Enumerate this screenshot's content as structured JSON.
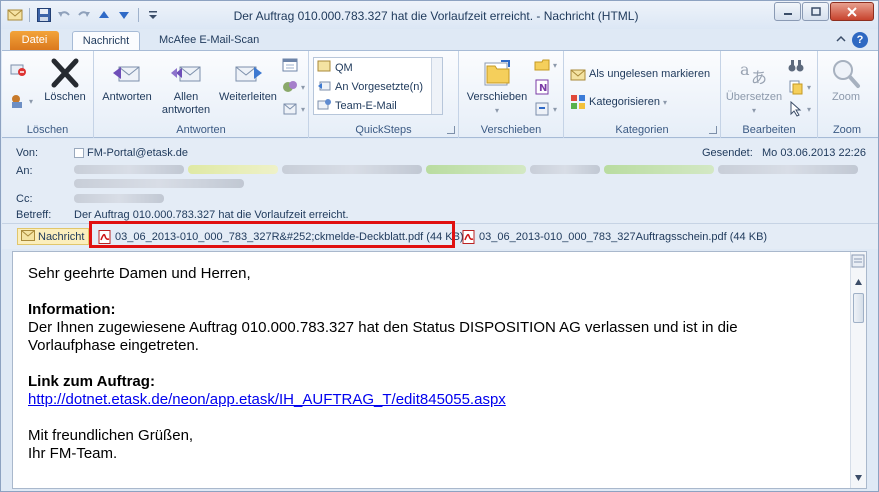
{
  "window": {
    "title": "Der Auftrag 010.000.783.327 hat die Vorlaufzeit erreicht.  -  Nachricht (HTML)"
  },
  "tabs": {
    "file": "Datei",
    "message": "Nachricht",
    "mcafee": "McAfee E-Mail-Scan"
  },
  "ribbon": {
    "delete_group": {
      "delete_label": "Löschen",
      "group_label": "Löschen"
    },
    "respond_group": {
      "reply": "Antworten",
      "reply_all_line1": "Allen",
      "reply_all_line2": "antworten",
      "forward": "Weiterleiten",
      "group_label": "Antworten"
    },
    "quicksteps": {
      "items": [
        "QM",
        "An Vorgesetzte(n)",
        "Team-E-Mail"
      ],
      "group_label": "QuickSteps"
    },
    "move_group": {
      "move_label": "Verschieben",
      "group_label": "Verschieben"
    },
    "tags_group": {
      "mark_unread": "Als ungelesen markieren",
      "categorize": "Kategorisieren",
      "group_label": "Kategorien"
    },
    "editing_group": {
      "translate": "Übersetzen",
      "group_label": "Bearbeiten"
    },
    "zoom_group": {
      "zoom": "Zoom",
      "group_label": "Zoom"
    }
  },
  "header": {
    "from_label": "Von:",
    "from_value": "FM-Portal@etask.de",
    "to_label": "An:",
    "cc_label": "Cc:",
    "subject_label": "Betreff:",
    "subject_value": "Der Auftrag 010.000.783.327 hat die Vorlaufzeit erreicht.",
    "sent_label": "Gesendet:",
    "sent_value": "Mo 03.06.2013 22:26"
  },
  "attachments": {
    "message_tab": "Nachricht",
    "files": [
      "03_06_2013-010_000_783_327R&#252;ckmelde-Deckblatt.pdf (44 KB)",
      "03_06_2013-010_000_783_327Auftragsschein.pdf (44 KB)"
    ]
  },
  "body": {
    "greeting": "Sehr geehrte Damen und Herren,",
    "info_heading": "Information:",
    "info_text_line1": "Der Ihnen zugewiesene Auftrag 010.000.783.327 hat den Status DISPOSITION AG verlassen und ist in die",
    "info_text_line2": "Vorlaufphase eingetreten.",
    "link_heading": "Link zum Auftrag:",
    "link_url": "http://dotnet.etask.de/neon/app.etask/IH_AUFTRAG_T/edit845055.aspx",
    "closing_line1": "Mit freundlichen Grüßen,",
    "closing_line2": "Ihr FM-Team."
  },
  "colors": {
    "file_tab": "#e8882a",
    "highlight_box": "#e01010",
    "link": "#0000ee"
  }
}
